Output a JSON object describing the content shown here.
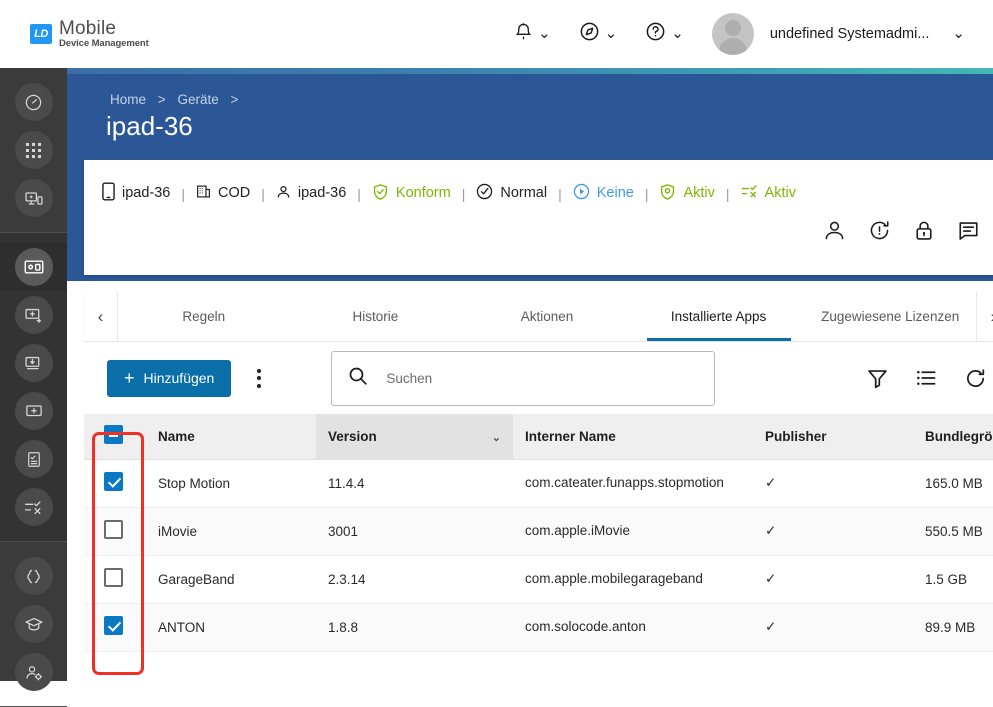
{
  "app": {
    "logo_badge": "LD",
    "logo_title": "Mobile",
    "logo_subtitle": "Device Management"
  },
  "topbar": {
    "notifications_icon": "bell-icon",
    "compass_icon": "compass-icon",
    "help_icon": "question-circle-icon",
    "chevron": "⌄",
    "user_name": "undefined Systemadmi..."
  },
  "sidebar": {
    "items": [
      {
        "name": "dashboard",
        "icon": "speedometer-icon",
        "active": false
      },
      {
        "name": "apps-grid",
        "icon": "grid-dots-icon",
        "active": false
      },
      {
        "name": "device-enrollment",
        "icon": "monitor-star-icon",
        "active": false
      },
      {
        "name": "devices",
        "icon": "devices-icon",
        "active": true
      },
      {
        "name": "add-device",
        "icon": "monitor-plus-arrow-icon",
        "active": false
      },
      {
        "name": "download-device",
        "icon": "monitor-download-icon",
        "active": false
      },
      {
        "name": "device-add",
        "icon": "monitor-plus-icon",
        "active": false
      },
      {
        "name": "checklist",
        "icon": "document-check-icon",
        "active": false
      },
      {
        "name": "tasks",
        "icon": "list-check-icon",
        "active": false
      },
      {
        "name": "scripts",
        "icon": "braces-icon",
        "active": false
      },
      {
        "name": "training",
        "icon": "graduation-cap-icon",
        "active": false
      },
      {
        "name": "user-settings",
        "icon": "user-gear-icon",
        "active": false
      }
    ]
  },
  "breadcrumb": {
    "home": "Home",
    "sep": ">",
    "parent": "Geräte",
    "trailing_sep": ">"
  },
  "page": {
    "title": "ipad-36"
  },
  "device_card": {
    "chips": [
      {
        "icon": "phone-icon",
        "label": "ipad-36",
        "color": "dark"
      },
      {
        "icon": "building-icon",
        "label": "COD",
        "color": "dark"
      },
      {
        "icon": "user-icon",
        "label": "ipad-36",
        "color": "dark"
      },
      {
        "icon": "shield-check-icon",
        "label": "Konform",
        "color": "green"
      },
      {
        "icon": "circle-check-icon",
        "label": "Normal",
        "color": "dark"
      },
      {
        "icon": "circle-play-icon",
        "label": "Keine",
        "color": "blue"
      },
      {
        "icon": "shield-target-icon",
        "label": "Aktiv",
        "color": "green"
      },
      {
        "icon": "list-check-icon",
        "label": "Aktiv",
        "color": "green"
      }
    ],
    "separator": "|",
    "actions": [
      {
        "name": "assign-user",
        "icon": "user-icon"
      },
      {
        "name": "refresh-info",
        "icon": "clock-refresh-icon"
      },
      {
        "name": "lock-device",
        "icon": "lock-icon"
      },
      {
        "name": "send-message",
        "icon": "message-icon"
      }
    ]
  },
  "tabs": {
    "prev_arrow": "‹",
    "next_arrow": "›",
    "items": [
      {
        "label": "Regeln",
        "active": false
      },
      {
        "label": "Historie",
        "active": false
      },
      {
        "label": "Aktionen",
        "active": false
      },
      {
        "label": "Installierte Apps",
        "active": true
      },
      {
        "label": "Zugewiesene Lizenzen",
        "active": false
      }
    ]
  },
  "toolbar": {
    "add_label": "Hinzufügen",
    "add_plus": "+",
    "kebab_icon": "more-vertical-icon",
    "search_placeholder": "Suchen",
    "search_value": "",
    "search_icon": "search-icon",
    "filter_icon": "filter-icon",
    "columns_icon": "list-icon",
    "refresh_icon": "refresh-icon"
  },
  "table": {
    "select_all_state": "indeterminate",
    "columns": [
      {
        "key": "check",
        "label": ""
      },
      {
        "key": "name",
        "label": "Name"
      },
      {
        "key": "version",
        "label": "Version",
        "sorted": true,
        "sort_icon": "⌄"
      },
      {
        "key": "internal",
        "label": "Interner Name"
      },
      {
        "key": "publisher",
        "label": "Publisher"
      },
      {
        "key": "size",
        "label": "Bundlegröße"
      }
    ],
    "rows": [
      {
        "checked": true,
        "name": "Stop Motion",
        "version": "11.4.4",
        "internal": "com.cateater.funapps.stopmotion",
        "publisher": "✓",
        "size": "165.0 MB"
      },
      {
        "checked": false,
        "name": "iMovie",
        "version": "3001",
        "internal": "com.apple.iMovie",
        "publisher": "✓",
        "size": "550.5 MB"
      },
      {
        "checked": false,
        "name": "GarageBand",
        "version": "2.3.14",
        "internal": "com.apple.mobilegarageband",
        "publisher": "✓",
        "size": "1.5 GB"
      },
      {
        "checked": true,
        "name": "ANTON",
        "version": "1.8.8",
        "internal": "com.solocode.anton",
        "publisher": "✓",
        "size": "89.9 MB"
      }
    ]
  },
  "colors": {
    "brand_blue": "#0a6ea8",
    "header_blue": "#2b5797",
    "accent_green": "#7ab800",
    "accent_lightblue": "#3e9bdd",
    "checkbox_blue": "#0a78c2",
    "annotation_red": "#ee3124",
    "sidebar_bg": "#3b3b3b"
  }
}
